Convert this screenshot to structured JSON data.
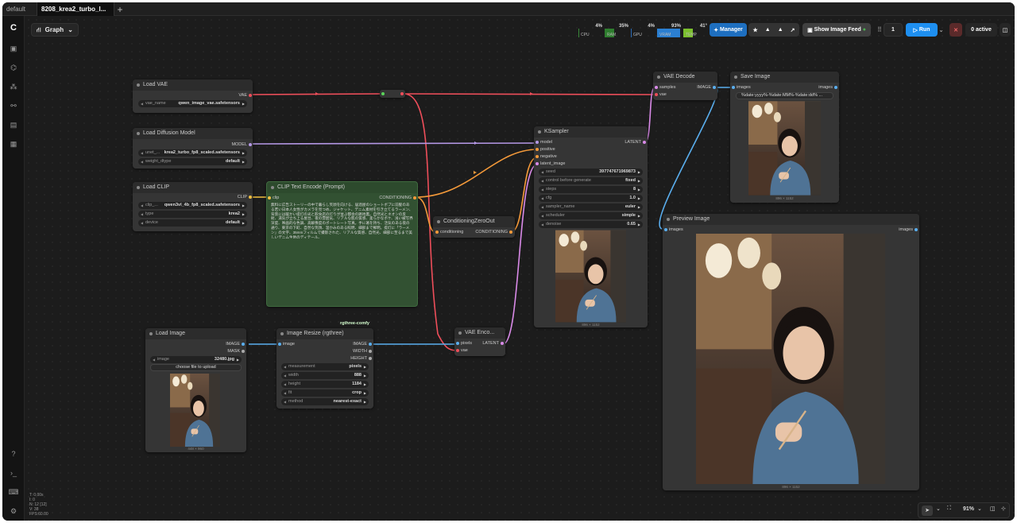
{
  "tabs": [
    {
      "label": "default",
      "active": false
    },
    {
      "label": "8208_krea2_turbo_l...",
      "active": true
    }
  ],
  "graph_label": "Graph",
  "monitors": [
    {
      "label": "CPU",
      "pct": "4%",
      "color": "#3a8a3a"
    },
    {
      "label": "RAM",
      "pct": "35%",
      "color": "#2e7d2e"
    },
    {
      "label": "GPU",
      "pct": "4%",
      "color": "#2a6ab4"
    },
    {
      "label": "VRAM",
      "pct": "93%",
      "color": "#2b7fd1"
    },
    {
      "label": "TEMP",
      "pct": "41°",
      "color": "#7bbf2e"
    }
  ],
  "toolbar": {
    "manager": "Manager",
    "show_feed": "Show Image Feed",
    "queue_count": "1",
    "run": "Run",
    "active": "0 active"
  },
  "colors": {
    "accent": "#1e8ff0",
    "clip_node": "#325132"
  },
  "nodes": {
    "load_vae": {
      "title": "Load VAE",
      "out": "VAE",
      "w1n": "vae_name",
      "w1v": "qwen_image_vae.safetensors"
    },
    "load_diffusion": {
      "title": "Load Diffusion Model",
      "out": "MODEL",
      "w1n": "unet_...",
      "w1v": "krea2_turbo_fp8_scaled.safetensors",
      "w2n": "weight_dtype",
      "w2v": "default"
    },
    "load_clip": {
      "title": "Load CLIP",
      "out": "CLIP",
      "w1n": "clip_...",
      "w1v": "qwen3vl_4b_fp8_scaled.safetensors",
      "w2n": "type",
      "w2v": "krea2",
      "w3n": "device",
      "w3v": "default"
    },
    "clip_text": {
      "title": "CLIP Text Encode (Prompt)",
      "in": "clip",
      "out": "CONDITIONING",
      "prompt": "無料に広告ストーリーの中で暮らし笑顔を向ける、居酒屋のショートボブに前髪のある若い日本人女性がカメラを見つめ、ジャケット、デニム素材を引き立てるラーメン、背景には暖かい提灯の光と飲食店の灯りが並ぶ都会の路地裏。自然光とネオンの反射、湯気が立ち上る屋台、夜の雰囲気、リアルな肌の質感、柔らかなボケ、浅い被写界深度、映画的な色調、高解像度のポートレート写真。手に箸を持ち、活気のある夜の通り、東京の下町、自然な笑顔、温かみのある照明、細部まで鮮明。提灯に「ラーメン」の文字、35mmフィルムで撮影された、リアルな質感、自然光、細部に至るまで美しいデニム生地のディテール。"
    },
    "zero_out": {
      "title": "ConditioningZeroOut",
      "in": "conditioning",
      "out": "CONDITIONING"
    },
    "ksampler": {
      "title": "KSampler",
      "in1": "model",
      "in2": "positive",
      "in3": "negative",
      "in4": "latent_image",
      "out": "LATENT",
      "widgets": [
        {
          "n": "seed",
          "v": "397747671969873"
        },
        {
          "n": "control before generate",
          "v": "fixed"
        },
        {
          "n": "steps",
          "v": "8"
        },
        {
          "n": "cfg",
          "v": "1.0"
        },
        {
          "n": "sampler_name",
          "v": "euler"
        },
        {
          "n": "scheduler",
          "v": "simple"
        },
        {
          "n": "denoise",
          "v": "0.65"
        }
      ],
      "caption": "896 × 1152"
    },
    "vae_decode": {
      "title": "VAE Decode",
      "in1": "samples",
      "in2": "vae",
      "out": "IMAGE"
    },
    "save_image": {
      "title": "Save Image",
      "in": "images",
      "out": "images",
      "w1v": "%date:yyyy%-%date:MM%-%date:dd% ...",
      "caption": "896 × 1152"
    },
    "preview": {
      "title": "Preview Image",
      "in": "images",
      "out": "images",
      "caption": "896 × 1152"
    },
    "load_image": {
      "title": "Load Image",
      "out1": "IMAGE",
      "out2": "MASK",
      "w1n": "image",
      "w1v": "32480.jpg",
      "upload": "choose file to upload",
      "caption": "448 × 960"
    },
    "resize": {
      "badge": "rgthree-comfy",
      "title": "Image Resize (rgthree)",
      "in": "image",
      "out1": "IMAGE",
      "out2": "WIDTH",
      "out3": "HEIGHT",
      "widgets": [
        {
          "n": "measurement",
          "v": "pixels"
        },
        {
          "n": "width",
          "v": "888"
        },
        {
          "n": "height",
          "v": "1184"
        },
        {
          "n": "fit",
          "v": "crop"
        },
        {
          "n": "method",
          "v": "nearest-exact"
        }
      ]
    },
    "vae_encode": {
      "title": "VAE Enco...",
      "in1": "pixels",
      "in2": "vae",
      "out": "LATENT"
    }
  },
  "stats": [
    "T: 0.00s",
    "I: 0",
    "N: 12 [12]",
    "V: 38",
    "FPS:60.00"
  ],
  "zoom": "91%"
}
